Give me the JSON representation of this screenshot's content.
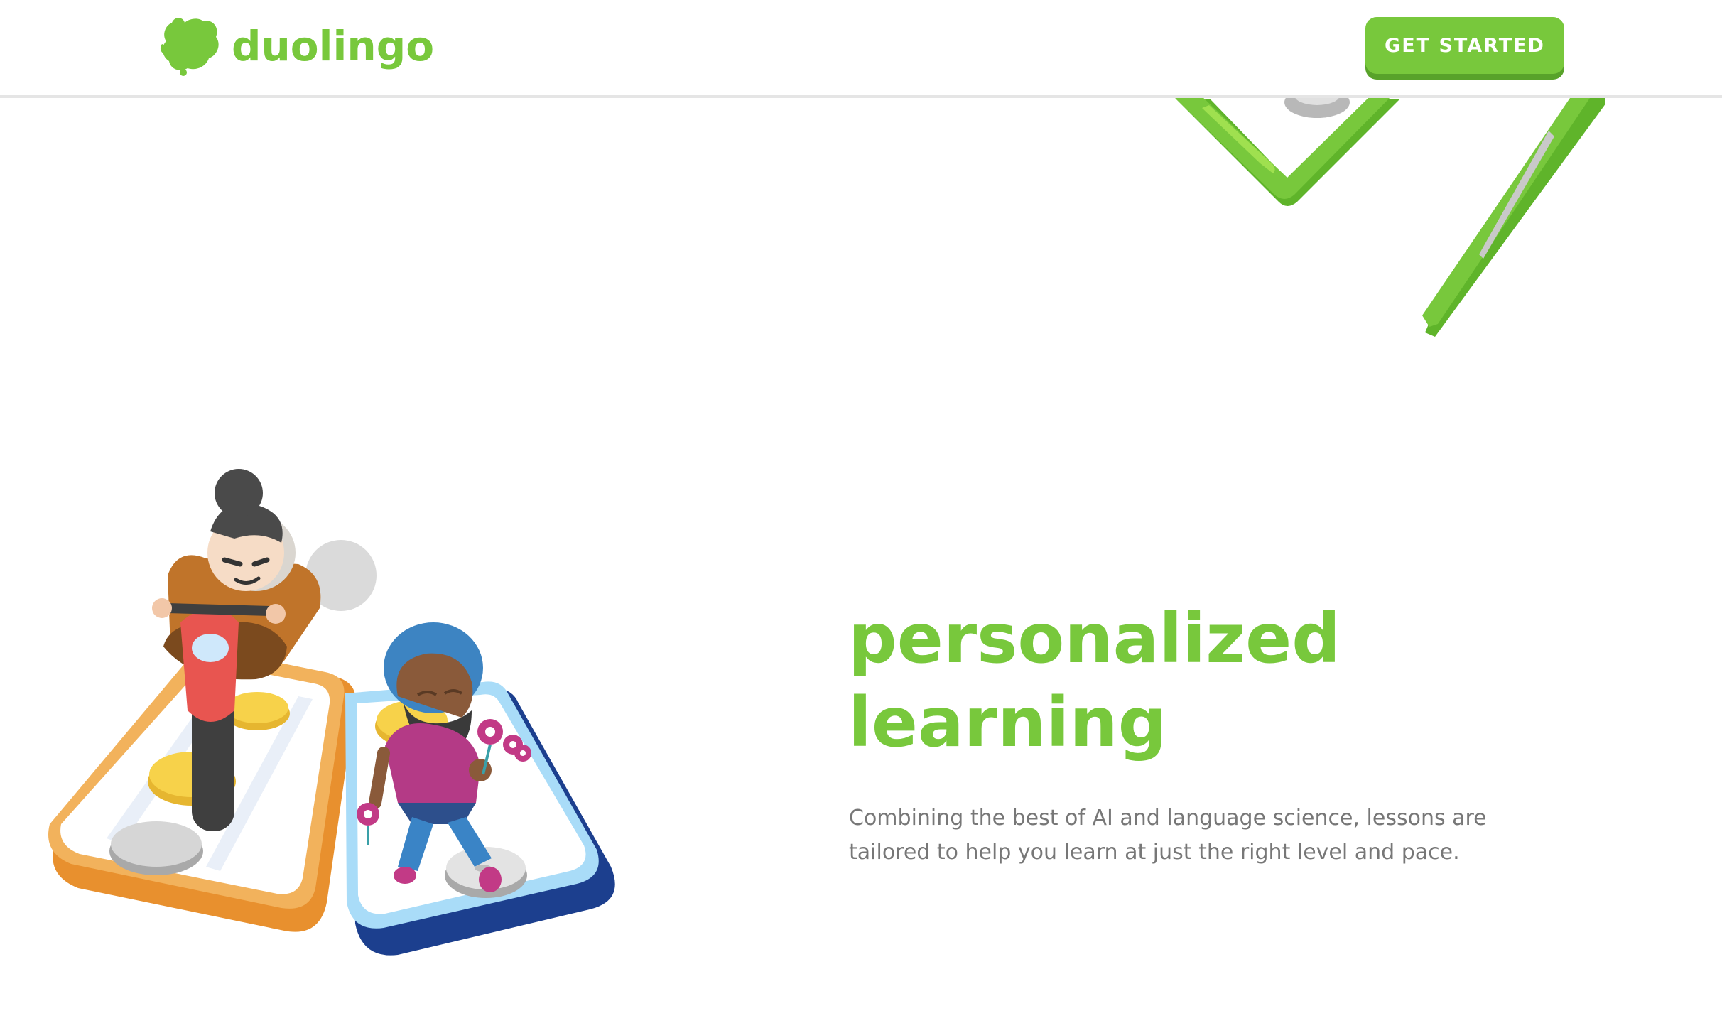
{
  "header": {
    "logo_text": "duolingo",
    "cta_label": "GET STARTED"
  },
  "hero": {
    "title_line1": "personalized",
    "title_line2": "learning",
    "description": "Combining the best of AI and language science, lessons are tailored to help you learn at just the right level and pace."
  },
  "colors": {
    "brand_green": "#78c83c",
    "button_shadow": "#58a22a",
    "body_text": "#777777",
    "divider": "#e5e5e5"
  },
  "icons": [
    "duo-owl-logo-icon",
    "lesson-path-illustration",
    "phone-characters-illustration"
  ]
}
